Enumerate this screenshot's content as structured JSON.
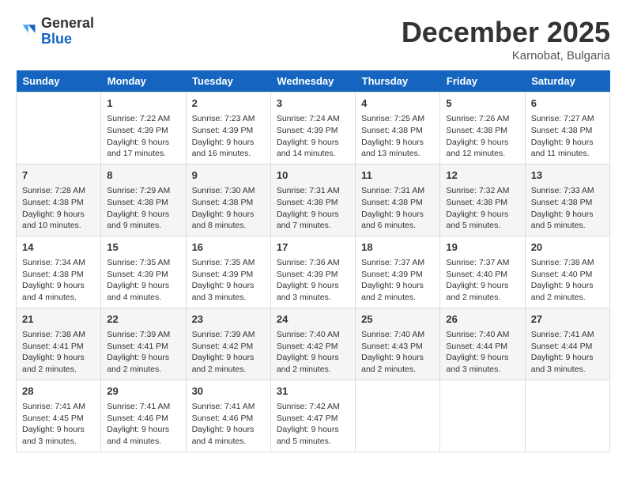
{
  "header": {
    "logo_general": "General",
    "logo_blue": "Blue",
    "month_title": "December 2025",
    "location": "Karnobat, Bulgaria"
  },
  "calendar": {
    "days_of_week": [
      "Sunday",
      "Monday",
      "Tuesday",
      "Wednesday",
      "Thursday",
      "Friday",
      "Saturday"
    ],
    "weeks": [
      [
        {
          "day": "",
          "sunrise": "",
          "sunset": "",
          "daylight": ""
        },
        {
          "day": "1",
          "sunrise": "Sunrise: 7:22 AM",
          "sunset": "Sunset: 4:39 PM",
          "daylight": "Daylight: 9 hours and 17 minutes."
        },
        {
          "day": "2",
          "sunrise": "Sunrise: 7:23 AM",
          "sunset": "Sunset: 4:39 PM",
          "daylight": "Daylight: 9 hours and 16 minutes."
        },
        {
          "day": "3",
          "sunrise": "Sunrise: 7:24 AM",
          "sunset": "Sunset: 4:39 PM",
          "daylight": "Daylight: 9 hours and 14 minutes."
        },
        {
          "day": "4",
          "sunrise": "Sunrise: 7:25 AM",
          "sunset": "Sunset: 4:38 PM",
          "daylight": "Daylight: 9 hours and 13 minutes."
        },
        {
          "day": "5",
          "sunrise": "Sunrise: 7:26 AM",
          "sunset": "Sunset: 4:38 PM",
          "daylight": "Daylight: 9 hours and 12 minutes."
        },
        {
          "day": "6",
          "sunrise": "Sunrise: 7:27 AM",
          "sunset": "Sunset: 4:38 PM",
          "daylight": "Daylight: 9 hours and 11 minutes."
        }
      ],
      [
        {
          "day": "7",
          "sunrise": "Sunrise: 7:28 AM",
          "sunset": "Sunset: 4:38 PM",
          "daylight": "Daylight: 9 hours and 10 minutes."
        },
        {
          "day": "8",
          "sunrise": "Sunrise: 7:29 AM",
          "sunset": "Sunset: 4:38 PM",
          "daylight": "Daylight: 9 hours and 9 minutes."
        },
        {
          "day": "9",
          "sunrise": "Sunrise: 7:30 AM",
          "sunset": "Sunset: 4:38 PM",
          "daylight": "Daylight: 9 hours and 8 minutes."
        },
        {
          "day": "10",
          "sunrise": "Sunrise: 7:31 AM",
          "sunset": "Sunset: 4:38 PM",
          "daylight": "Daylight: 9 hours and 7 minutes."
        },
        {
          "day": "11",
          "sunrise": "Sunrise: 7:31 AM",
          "sunset": "Sunset: 4:38 PM",
          "daylight": "Daylight: 9 hours and 6 minutes."
        },
        {
          "day": "12",
          "sunrise": "Sunrise: 7:32 AM",
          "sunset": "Sunset: 4:38 PM",
          "daylight": "Daylight: 9 hours and 5 minutes."
        },
        {
          "day": "13",
          "sunrise": "Sunrise: 7:33 AM",
          "sunset": "Sunset: 4:38 PM",
          "daylight": "Daylight: 9 hours and 5 minutes."
        }
      ],
      [
        {
          "day": "14",
          "sunrise": "Sunrise: 7:34 AM",
          "sunset": "Sunset: 4:38 PM",
          "daylight": "Daylight: 9 hours and 4 minutes."
        },
        {
          "day": "15",
          "sunrise": "Sunrise: 7:35 AM",
          "sunset": "Sunset: 4:39 PM",
          "daylight": "Daylight: 9 hours and 4 minutes."
        },
        {
          "day": "16",
          "sunrise": "Sunrise: 7:35 AM",
          "sunset": "Sunset: 4:39 PM",
          "daylight": "Daylight: 9 hours and 3 minutes."
        },
        {
          "day": "17",
          "sunrise": "Sunrise: 7:36 AM",
          "sunset": "Sunset: 4:39 PM",
          "daylight": "Daylight: 9 hours and 3 minutes."
        },
        {
          "day": "18",
          "sunrise": "Sunrise: 7:37 AM",
          "sunset": "Sunset: 4:39 PM",
          "daylight": "Daylight: 9 hours and 2 minutes."
        },
        {
          "day": "19",
          "sunrise": "Sunrise: 7:37 AM",
          "sunset": "Sunset: 4:40 PM",
          "daylight": "Daylight: 9 hours and 2 minutes."
        },
        {
          "day": "20",
          "sunrise": "Sunrise: 7:38 AM",
          "sunset": "Sunset: 4:40 PM",
          "daylight": "Daylight: 9 hours and 2 minutes."
        }
      ],
      [
        {
          "day": "21",
          "sunrise": "Sunrise: 7:38 AM",
          "sunset": "Sunset: 4:41 PM",
          "daylight": "Daylight: 9 hours and 2 minutes."
        },
        {
          "day": "22",
          "sunrise": "Sunrise: 7:39 AM",
          "sunset": "Sunset: 4:41 PM",
          "daylight": "Daylight: 9 hours and 2 minutes."
        },
        {
          "day": "23",
          "sunrise": "Sunrise: 7:39 AM",
          "sunset": "Sunset: 4:42 PM",
          "daylight": "Daylight: 9 hours and 2 minutes."
        },
        {
          "day": "24",
          "sunrise": "Sunrise: 7:40 AM",
          "sunset": "Sunset: 4:42 PM",
          "daylight": "Daylight: 9 hours and 2 minutes."
        },
        {
          "day": "25",
          "sunrise": "Sunrise: 7:40 AM",
          "sunset": "Sunset: 4:43 PM",
          "daylight": "Daylight: 9 hours and 2 minutes."
        },
        {
          "day": "26",
          "sunrise": "Sunrise: 7:40 AM",
          "sunset": "Sunset: 4:44 PM",
          "daylight": "Daylight: 9 hours and 3 minutes."
        },
        {
          "day": "27",
          "sunrise": "Sunrise: 7:41 AM",
          "sunset": "Sunset: 4:44 PM",
          "daylight": "Daylight: 9 hours and 3 minutes."
        }
      ],
      [
        {
          "day": "28",
          "sunrise": "Sunrise: 7:41 AM",
          "sunset": "Sunset: 4:45 PM",
          "daylight": "Daylight: 9 hours and 3 minutes."
        },
        {
          "day": "29",
          "sunrise": "Sunrise: 7:41 AM",
          "sunset": "Sunset: 4:46 PM",
          "daylight": "Daylight: 9 hours and 4 minutes."
        },
        {
          "day": "30",
          "sunrise": "Sunrise: 7:41 AM",
          "sunset": "Sunset: 4:46 PM",
          "daylight": "Daylight: 9 hours and 4 minutes."
        },
        {
          "day": "31",
          "sunrise": "Sunrise: 7:42 AM",
          "sunset": "Sunset: 4:47 PM",
          "daylight": "Daylight: 9 hours and 5 minutes."
        },
        {
          "day": "",
          "sunrise": "",
          "sunset": "",
          "daylight": ""
        },
        {
          "day": "",
          "sunrise": "",
          "sunset": "",
          "daylight": ""
        },
        {
          "day": "",
          "sunrise": "",
          "sunset": "",
          "daylight": ""
        }
      ]
    ]
  }
}
